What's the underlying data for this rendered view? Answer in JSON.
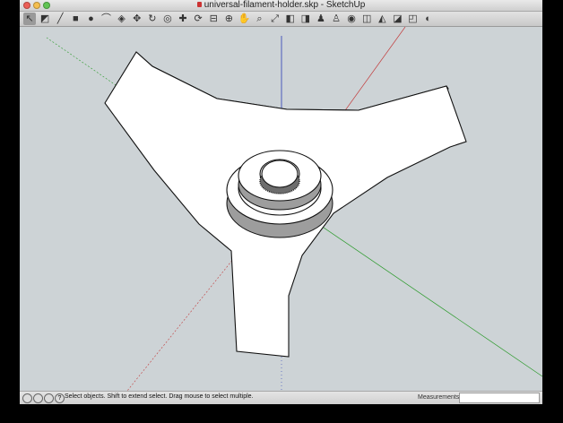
{
  "window": {
    "title": "universal-filament-holder.skp - SketchUp"
  },
  "colors": {
    "close": "#ec5e56",
    "minimize": "#f5bf4f",
    "zoom": "#61c554",
    "viewport_bg": "#cdd3d6",
    "axis_red": "#c23b3b",
    "axis_green": "#2a9a2a",
    "axis_blue": "#2b3cb5",
    "model_face": "#ffffff",
    "model_side": "#9d9d9d",
    "model_edge": "#111111"
  },
  "toolbar": {
    "tools": [
      {
        "name": "select-tool",
        "glyph": "↖"
      },
      {
        "name": "eraser-tool",
        "glyph": "◩"
      },
      {
        "name": "pencil-tool",
        "glyph": "╱"
      },
      {
        "name": "rectangle-tool",
        "glyph": "■"
      },
      {
        "name": "circle-tool",
        "glyph": "●"
      },
      {
        "name": "arc-tool",
        "glyph": "⌒"
      },
      {
        "name": "push-pull-tool",
        "glyph": "◈"
      },
      {
        "name": "move-tool",
        "glyph": "✥"
      },
      {
        "name": "rotate-tool",
        "glyph": "↻"
      },
      {
        "name": "offset-tool",
        "glyph": "◎"
      },
      {
        "name": "scale-tool",
        "glyph": "✚"
      },
      {
        "name": "follow-me-tool",
        "glyph": "⟳"
      },
      {
        "name": "tape-measure-tool",
        "glyph": "⊟"
      },
      {
        "name": "orbit-tool",
        "glyph": "⊕"
      },
      {
        "name": "pan-tool",
        "glyph": "✋"
      },
      {
        "name": "zoom-tool",
        "glyph": "⌕"
      },
      {
        "name": "zoom-extents-tool",
        "glyph": "⤢"
      },
      {
        "name": "previous-view-tool",
        "glyph": "◧"
      },
      {
        "name": "next-view-tool",
        "glyph": "◨"
      },
      {
        "name": "position-camera-tool",
        "glyph": "♟"
      },
      {
        "name": "walk-tool",
        "glyph": "♙"
      },
      {
        "name": "look-around-tool",
        "glyph": "◉"
      },
      {
        "name": "section-plane-tool",
        "glyph": "◫"
      },
      {
        "name": "paint-bucket-tool",
        "glyph": "◭"
      },
      {
        "name": "components-tool",
        "glyph": "◪"
      },
      {
        "name": "warehouse-tool",
        "glyph": "◰"
      },
      {
        "name": "extension-tool",
        "glyph": "◐"
      }
    ]
  },
  "status": {
    "hint": "Select objects. Shift to extend select. Drag mouse to select multiple.",
    "measurements_label": "Measurements",
    "measurements_value": "",
    "help_glyph": "?"
  }
}
